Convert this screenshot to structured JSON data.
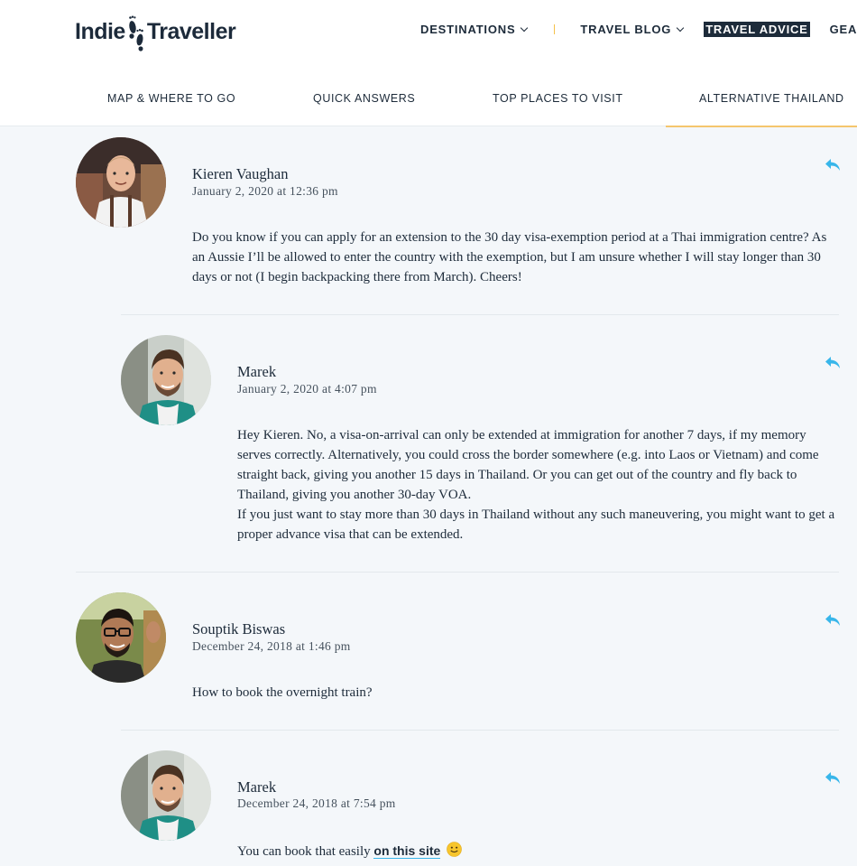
{
  "site": {
    "logo_part1": "Indie",
    "logo_part2": "Traveller"
  },
  "colors": {
    "accent_blue": "#38b6ea",
    "nav_dark": "#1d2b3a",
    "underline_yellow": "#f5c66d",
    "background": "#f4f7fa"
  },
  "nav": {
    "items": [
      {
        "label": "DESTINATIONS",
        "has_dropdown": true
      },
      {
        "label": "TRAVEL BLOG",
        "has_dropdown": true
      },
      {
        "label": "TRAVEL ADVICE",
        "active": true
      },
      {
        "label": "GEAR"
      }
    ]
  },
  "subnav": {
    "items": [
      {
        "label": "MAP & WHERE TO GO"
      },
      {
        "label": "QUICK ANSWERS"
      },
      {
        "label": "TOP PLACES TO VISIT"
      },
      {
        "label": "ALTERNATIVE THAILAND",
        "active": true
      }
    ]
  },
  "comments": [
    {
      "author": "Kieren Vaughan",
      "date": "January 2, 2020 at 12:36 pm",
      "paragraphs": [
        "Do you know if you can apply for an extension to the 30 day visa-exemption period at a Thai immigration centre? As an Aussie I’ll be allowed to enter the country with the exemption, but I am unsure whether I will stay longer than 30 days or not (I begin backpacking there from March). Cheers!"
      ],
      "icon": "reply-icon"
    },
    {
      "author": "Marek",
      "date": "January 2, 2020 at 4:07 pm",
      "paragraphs": [
        "Hey Kieren. No, a visa-on-arrival can only be extended at immigration for another 7 days, if my memory serves correctly. Alternatively, you could cross the border somewhere (e.g. into Laos or Vietnam) and come straight back, giving you another 15 days in Thailand. Or you can get out of the country and fly back to Thailand, giving you another 30-day VOA.",
        "If you just want to stay more than 30 days in Thailand without any such maneuvering, you might want to get a proper advance visa that can be extended."
      ],
      "icon": "reply-icon"
    },
    {
      "author": "Souptik Biswas",
      "date": "December 24, 2018 at 1:46 pm",
      "paragraphs": [
        "How to book the overnight train?"
      ],
      "icon": "reply-icon"
    },
    {
      "author": "Marek",
      "date": "December 24, 2018 at 7:54 pm",
      "text_before_link": "You can book that easily ",
      "link_text": "on this site",
      "emoji": "smiley-icon",
      "icon": "reply-icon"
    }
  ]
}
